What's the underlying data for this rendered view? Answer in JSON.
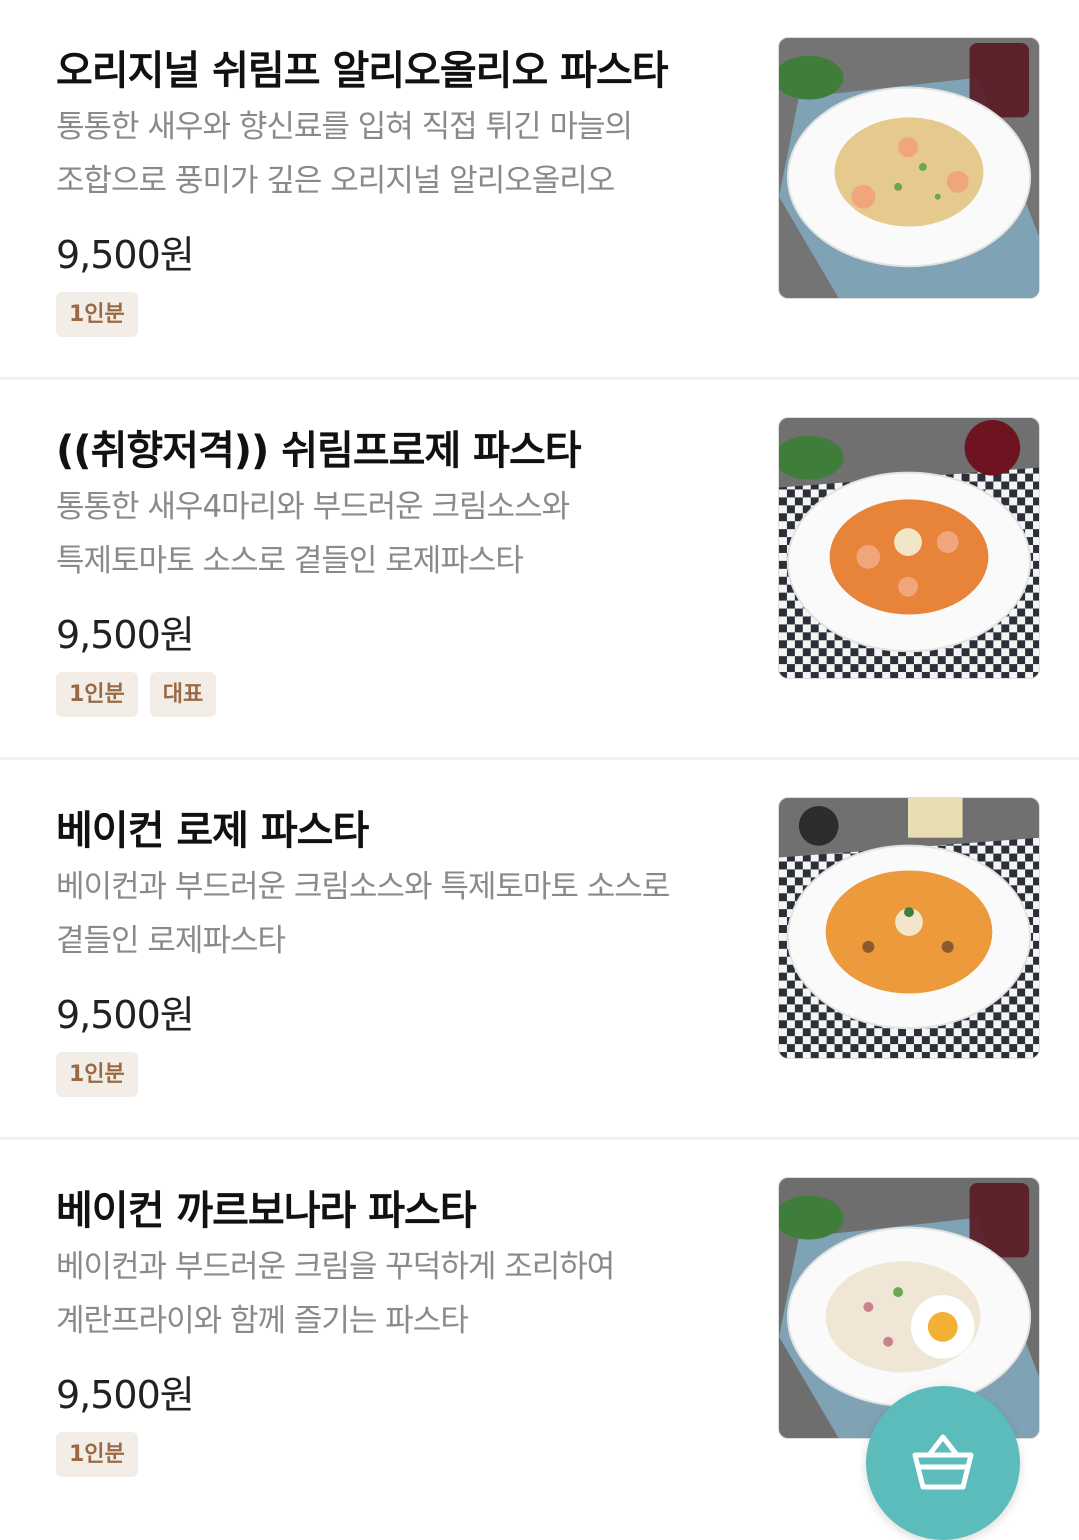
{
  "menu": {
    "items": [
      {
        "title": "오리지널 쉬림프 알리오올리오 파스타",
        "desc_lines": [
          "통통한 새우와 향신료를 입혀 직접 튀긴 마늘의",
          "조합으로 풍미가 깊은 오리지널 알리오올리오"
        ],
        "price": "9,500원",
        "tags": [
          "1인분"
        ],
        "image": {
          "sauce": "#e6c98c",
          "cloth": "#7fa3b5",
          "icon": "aglio-olio-pasta-photo"
        }
      },
      {
        "title": "((취향저격)) 쉬림프로제 파스타",
        "desc_lines": [
          "통통한 새우4마리와 부드러운 크림소스와",
          "특제토마토 소스로 곁들인 로제파스타"
        ],
        "price": "9,500원",
        "tags": [
          "1인분",
          "대표"
        ],
        "image": {
          "sauce": "#e8833a",
          "cloth": "#2a2f3a",
          "icon": "shrimp-rose-pasta-photo"
        }
      },
      {
        "title": "베이컨 로제 파스타",
        "desc_lines": [
          "베이컨과 부드러운 크림소스와 특제토마토 소스로",
          "곁들인 로제파스타"
        ],
        "price": "9,500원",
        "tags": [
          "1인분"
        ],
        "image": {
          "sauce": "#ec9a3c",
          "cloth": "#2a2f3a",
          "icon": "bacon-rose-pasta-photo"
        }
      },
      {
        "title": "베이컨 까르보나라 파스타",
        "desc_lines": [
          "베이컨과 부드러운 크림을 꾸덕하게 조리하여",
          "계란프라이와 함께 즐기는 파스타"
        ],
        "price": "9,500원",
        "tags": [
          "1인분"
        ],
        "image": {
          "sauce": "#efe6d6",
          "cloth": "#7fa3b5",
          "icon": "bacon-carbonara-pasta-photo"
        }
      }
    ]
  },
  "cart_button": {
    "icon": "basket-icon",
    "color": "#5cbcbc"
  },
  "colors": {
    "tag_bg": "#f2ede7",
    "tag_text": "#9a6a45",
    "desc": "#8a8a8a"
  }
}
